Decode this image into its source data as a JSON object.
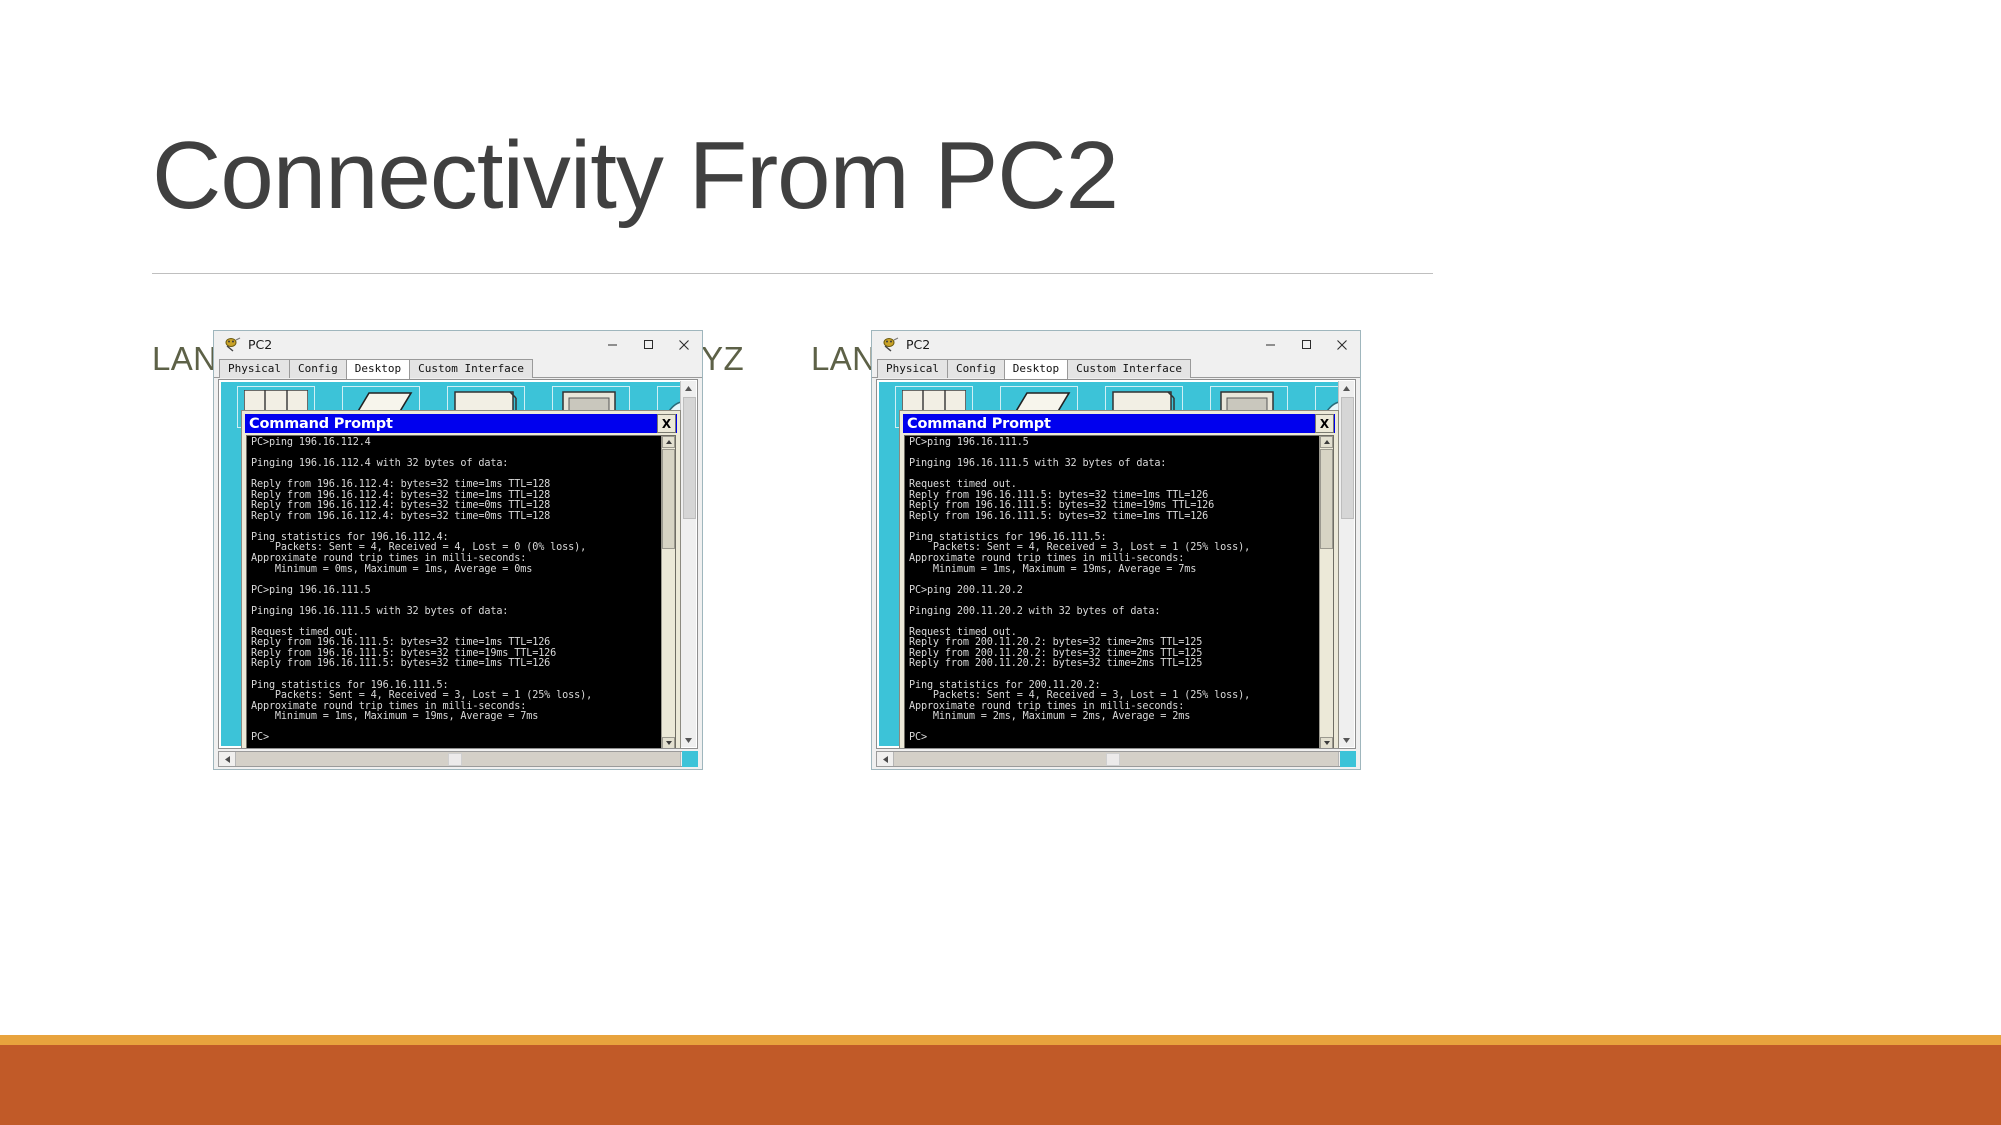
{
  "slide": {
    "title": "Connectivity From PC2",
    "subtitle_left": "LAN-LAN AND LAN-WAN-LAN OF XYZ",
    "subtitle_right": "LAN-WAN-LAN WITH INTERNET",
    "accent_orange_thin": "#e8a33d",
    "accent_orange_thick": "#c15a28",
    "title_color": "#404040",
    "subtitle_color": "#5d6147"
  },
  "window_left": {
    "title": "PC2",
    "controls": {
      "minimize": "–",
      "maximize": "□",
      "close": "✕"
    },
    "tabs": [
      {
        "label": "Physical",
        "active": false
      },
      {
        "label": "Config",
        "active": false
      },
      {
        "label": "Desktop",
        "active": true
      },
      {
        "label": "Custom Interface",
        "active": false
      }
    ],
    "command_prompt": {
      "title": "Command Prompt",
      "close_label": "X",
      "output": "PC>ping 196.16.112.4\n\nPinging 196.16.112.4 with 32 bytes of data:\n\nReply from 196.16.112.4: bytes=32 time=1ms TTL=128\nReply from 196.16.112.4: bytes=32 time=1ms TTL=128\nReply from 196.16.112.4: bytes=32 time=0ms TTL=128\nReply from 196.16.112.4: bytes=32 time=0ms TTL=128\n\nPing statistics for 196.16.112.4:\n    Packets: Sent = 4, Received = 4, Lost = 0 (0% loss),\nApproximate round trip times in milli-seconds:\n    Minimum = 0ms, Maximum = 1ms, Average = 0ms\n\nPC>ping 196.16.111.5\n\nPinging 196.16.111.5 with 32 bytes of data:\n\nRequest timed out.\nReply from 196.16.111.5: bytes=32 time=1ms TTL=126\nReply from 196.16.111.5: bytes=32 time=19ms TTL=126\nReply from 196.16.111.5: bytes=32 time=1ms TTL=126\n\nPing statistics for 196.16.111.5:\n    Packets: Sent = 4, Received = 3, Lost = 1 (25% loss),\nApproximate round trip times in milli-seconds:\n    Minimum = 1ms, Maximum = 19ms, Average = 7ms\n\nPC>"
    }
  },
  "window_right": {
    "title": "PC2",
    "controls": {
      "minimize": "–",
      "maximize": "□",
      "close": "✕"
    },
    "tabs": [
      {
        "label": "Physical",
        "active": false
      },
      {
        "label": "Config",
        "active": false
      },
      {
        "label": "Desktop",
        "active": true
      },
      {
        "label": "Custom Interface",
        "active": false
      }
    ],
    "command_prompt": {
      "title": "Command Prompt",
      "close_label": "X",
      "output": "PC>ping 196.16.111.5\n\nPinging 196.16.111.5 with 32 bytes of data:\n\nRequest timed out.\nReply from 196.16.111.5: bytes=32 time=1ms TTL=126\nReply from 196.16.111.5: bytes=32 time=19ms TTL=126\nReply from 196.16.111.5: bytes=32 time=1ms TTL=126\n\nPing statistics for 196.16.111.5:\n    Packets: Sent = 4, Received = 3, Lost = 1 (25% loss),\nApproximate round trip times in milli-seconds:\n    Minimum = 1ms, Maximum = 19ms, Average = 7ms\n\nPC>ping 200.11.20.2\n\nPinging 200.11.20.2 with 32 bytes of data:\n\nRequest timed out.\nReply from 200.11.20.2: bytes=32 time=2ms TTL=125\nReply from 200.11.20.2: bytes=32 time=2ms TTL=125\nReply from 200.11.20.2: bytes=32 time=2ms TTL=125\n\nPing statistics for 200.11.20.2:\n    Packets: Sent = 4, Received = 3, Lost = 1 (25% loss),\nApproximate round trip times in milli-seconds:\n    Minimum = 2ms, Maximum = 2ms, Average = 2ms\n\nPC>"
    }
  }
}
